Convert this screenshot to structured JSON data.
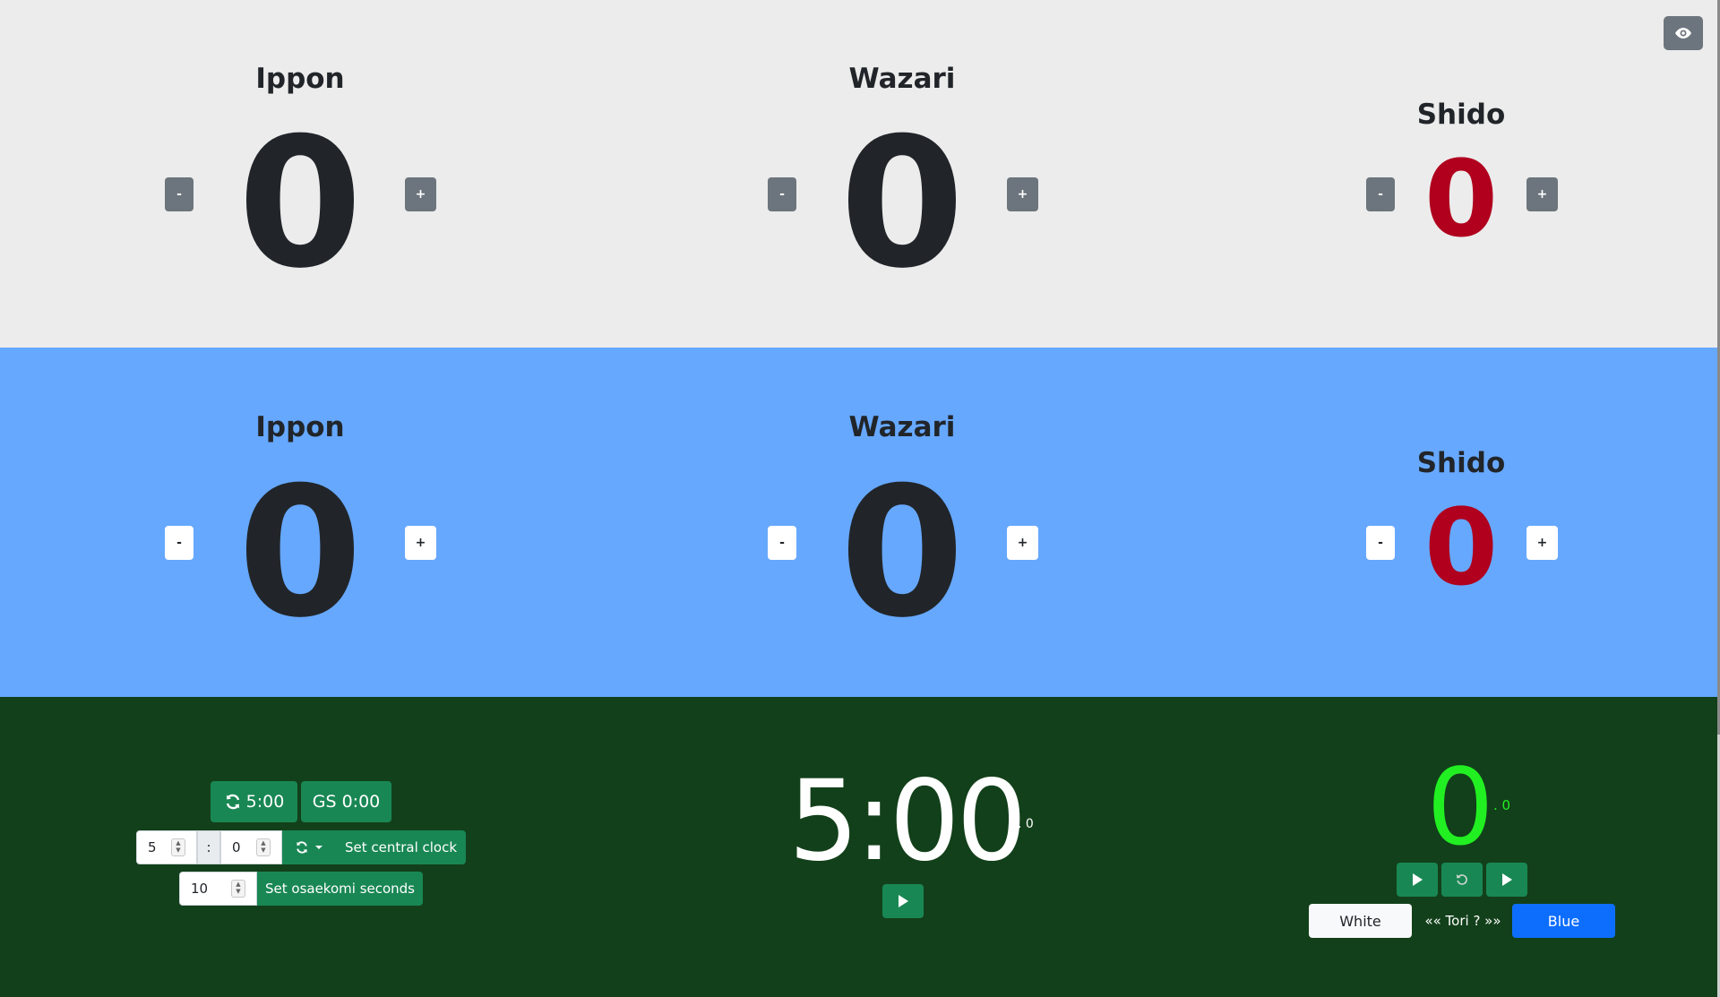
{
  "white": {
    "ippon": {
      "title": "Ippon",
      "value": "0"
    },
    "wazari": {
      "title": "Wazari",
      "value": "0"
    },
    "shido": {
      "title": "Shido",
      "value": "0"
    },
    "minus": "-",
    "plus": "+"
  },
  "blue": {
    "ippon": {
      "title": "Ippon",
      "value": "0"
    },
    "wazari": {
      "title": "Wazari",
      "value": "0"
    },
    "shido": {
      "title": "Shido",
      "value": "0"
    },
    "minus": "-",
    "plus": "+"
  },
  "controls": {
    "reset_time_label": "5:00",
    "gs_label": "GS 0:00",
    "minutes_value": "5",
    "colon": ":",
    "seconds_value": "0",
    "set_central_clock": "Set central clock",
    "osaekomi_seconds_value": "10",
    "set_osaekomi_seconds": "Set osaekomi seconds"
  },
  "clock": {
    "time": "5:00",
    "tenths": ". 0"
  },
  "osaekomi": {
    "value": "0",
    "tenths": ". 0",
    "tori_white": "White",
    "tori_label": "«« Tori ? »»",
    "tori_blue": "Blue"
  },
  "colors": {
    "white_panel": "#ececec",
    "blue_panel": "#66a8fe",
    "clock_panel": "#12401a",
    "shido": "#b0001e",
    "osaekomi": "#22ef22",
    "action": "#198754"
  }
}
